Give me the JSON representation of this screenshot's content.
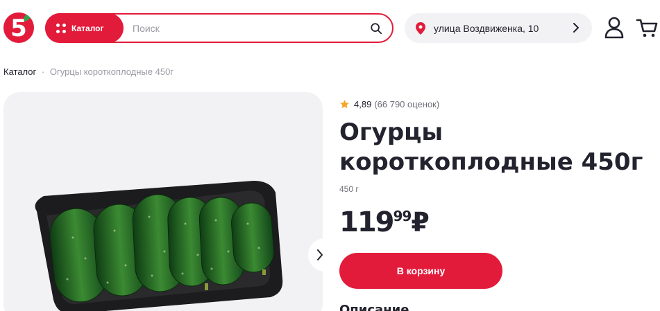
{
  "header": {
    "logo_text": "5",
    "catalog_label": "Каталог",
    "search_placeholder": "Поиск",
    "address": "улица Воздвиженка, 10"
  },
  "breadcrumb": {
    "root": "Каталог",
    "separator": "·",
    "current": "Огурцы короткоплодные 450г"
  },
  "product": {
    "rating": "4,89",
    "rating_count": "(66 790 оценок)",
    "title": "Огурцы короткоплодные 450г",
    "weight": "450 г",
    "price_rub": "119",
    "price_kop": "99",
    "currency": "₽",
    "add_to_cart": "В корзину",
    "description_heading": "Описание"
  },
  "icons": {
    "search": "search-icon",
    "location": "location-pin-icon",
    "chevron": "chevron-right-icon",
    "user": "user-icon",
    "cart": "cart-icon",
    "star": "star-icon"
  },
  "colors": {
    "brand_red": "#e31b3b",
    "star": "#f5a623",
    "text": "#23232f",
    "muted": "#9a9aa3"
  }
}
